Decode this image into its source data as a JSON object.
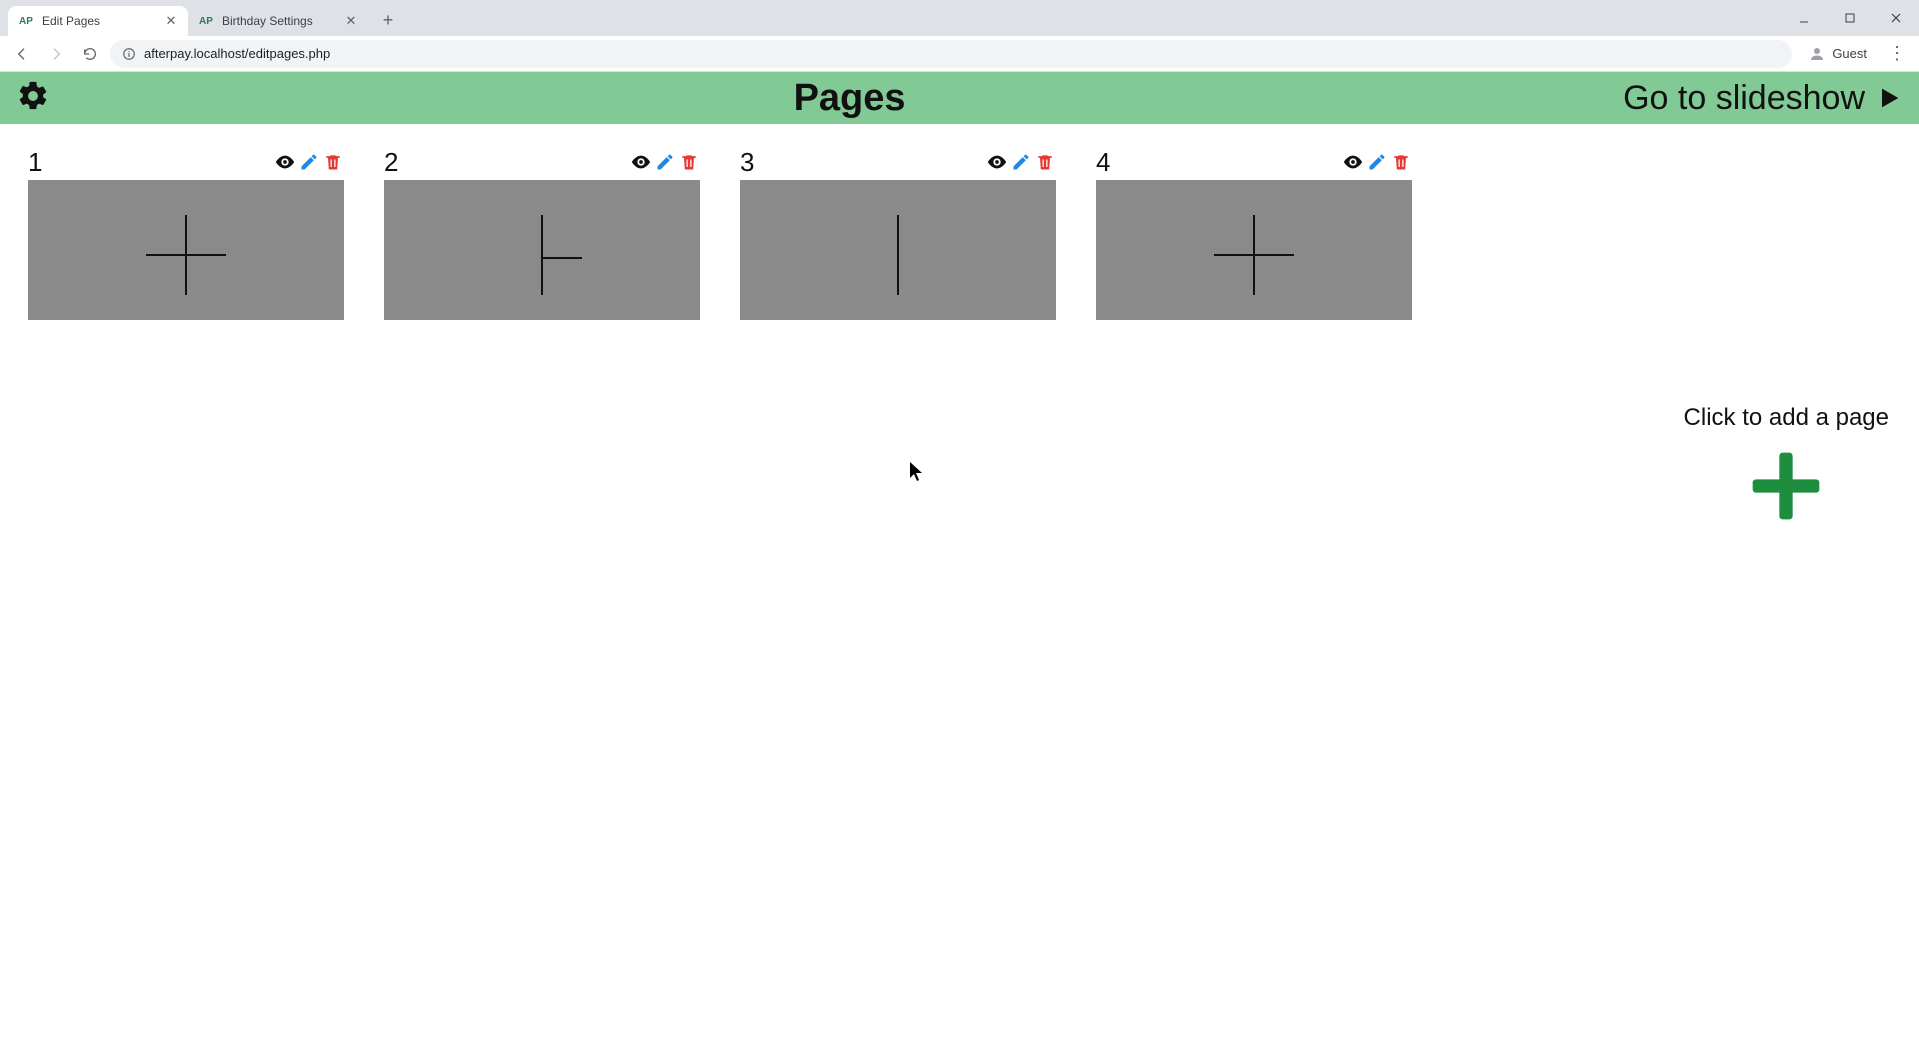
{
  "browser": {
    "tabs": [
      {
        "title": "Edit Pages",
        "active": true
      },
      {
        "title": "Birthday Settings",
        "active": false
      }
    ],
    "url": "afterpay.localhost/editpages.php",
    "profile_label": "Guest"
  },
  "header": {
    "title": "Pages",
    "slideshow_label": "Go to slideshow"
  },
  "pages": [
    {
      "number": "1",
      "layout": "cross-center"
    },
    {
      "number": "2",
      "layout": "t-shape"
    },
    {
      "number": "3",
      "layout": "vertical-line"
    },
    {
      "number": "4",
      "layout": "cross-center"
    }
  ],
  "add_page": {
    "label": "Click to add a page"
  },
  "colors": {
    "header_bg": "#81C995",
    "thumb_bg": "#8a8a8a",
    "edit_icon": "#1E88E5",
    "delete_icon": "#E53935",
    "eye_icon": "#111111",
    "plus_icon": "#1E8E3E"
  }
}
